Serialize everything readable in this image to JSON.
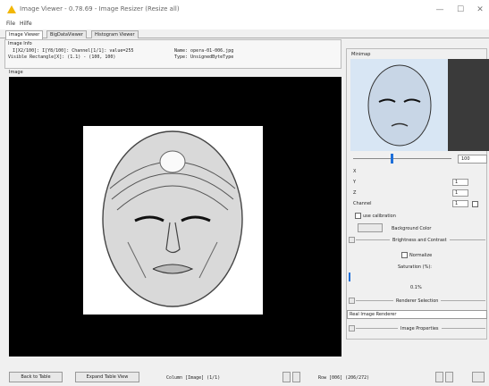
{
  "window": {
    "title": "Image Viewer - 0.78.69 - Image Resizer (Resize all)"
  },
  "menu": [
    "File",
    "Hilfe"
  ],
  "tabs": [
    "Image Viewer",
    "BigDataViewer",
    "Histogram Viewer"
  ],
  "info": {
    "section_title": "Image Info",
    "line1": "I[X2/100]: I[Y8/100]: Channel[1/1]: value=255",
    "line2": "Visible Rectangle[X]: (1.1) - (100, 100)",
    "name": "Name: opera-01-006.jpg",
    "type": "Type: UnsignedByteType"
  },
  "image_label": "Image",
  "minimap": {
    "label": "Minimap",
    "zoom": "100"
  },
  "controls": {
    "x_label": "X",
    "y_label": "Y",
    "z_label": "Z",
    "y_value": "1",
    "z_value": "1",
    "channel_label": "Channel",
    "channel_value": "1",
    "calibration": "use calibration",
    "background_color": "Background Color",
    "brightness_contrast": "Brightness and Contrast",
    "normalize": "Normalize",
    "saturation": "Saturation (%):",
    "saturation_value": "0.1%",
    "renderer_selection": "Renderer Selection",
    "renderer": "Real Image Renderer",
    "image_properties": "Image Properties"
  },
  "bottom": {
    "back": "Back to Table",
    "expand": "Expand Table View",
    "column": "Column [Image] (1/1)",
    "row": "Row [006] (206/272)"
  }
}
